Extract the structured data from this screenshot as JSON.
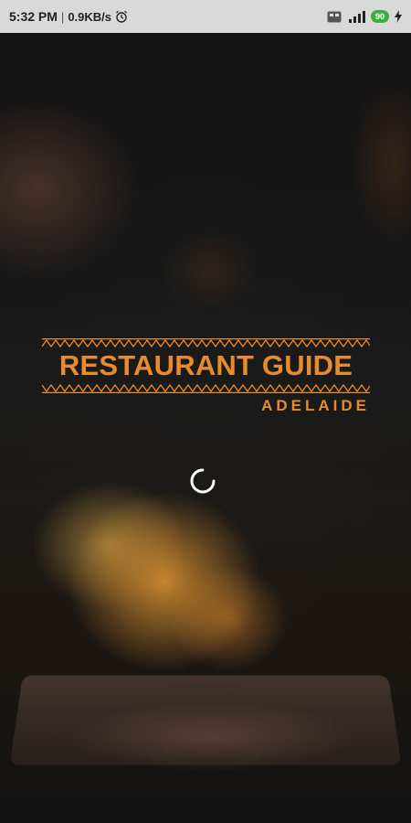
{
  "status_bar": {
    "time": "5:32 PM",
    "separator": "|",
    "network_speed": "0.9KB/s",
    "battery_level": "90",
    "icons": [
      "alarm-icon",
      "sim-icon",
      "signal-icon",
      "battery-icon",
      "charging-icon"
    ]
  },
  "splash": {
    "title": "RESTAURANT GUIDE",
    "subtitle": "ADELAIDE",
    "accent_color": "#e88b2a",
    "loading": true
  }
}
